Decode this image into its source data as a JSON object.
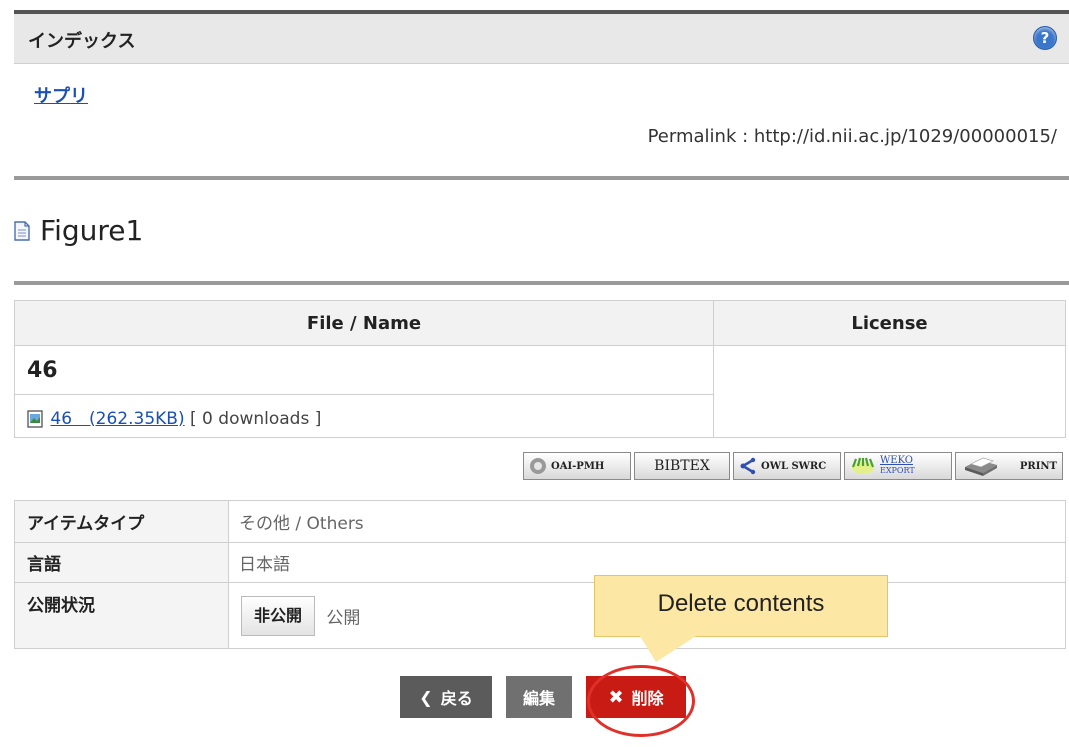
{
  "header": {
    "title": "インデックス",
    "help_icon": "?"
  },
  "index_link": "サプリ",
  "permalink": "Permalink : http://id.nii.ac.jp/1029/00000015/",
  "item_title": "Figure1",
  "files_table": {
    "col_file": "File / Name",
    "col_license": "License",
    "file_name": "46",
    "file_link": "46　(262.35KB)",
    "downloads": "[ 0 downloads ]",
    "license": ""
  },
  "exports": {
    "oai": "OAI-PMH",
    "bibtex": "BIBTEX",
    "owl": "OWL SWRC",
    "weko_top": "WEKO",
    "weko_bottom": "EXPORT",
    "print": "PRINT"
  },
  "meta": {
    "item_type_label": "アイテムタイプ",
    "item_type_value": "その他 / Others",
    "language_label": "言語",
    "language_value": "日本語",
    "status_label": "公開状況",
    "status_button": "非公開",
    "status_value": "公開"
  },
  "callout": "Delete contents",
  "buttons": {
    "back": "戻る",
    "edit": "編集",
    "delete": "削除"
  },
  "colors": {
    "link": "#1a4fb5",
    "delete": "#c81b14",
    "callout": "#fde7a4",
    "highlight": "#e0302a"
  }
}
